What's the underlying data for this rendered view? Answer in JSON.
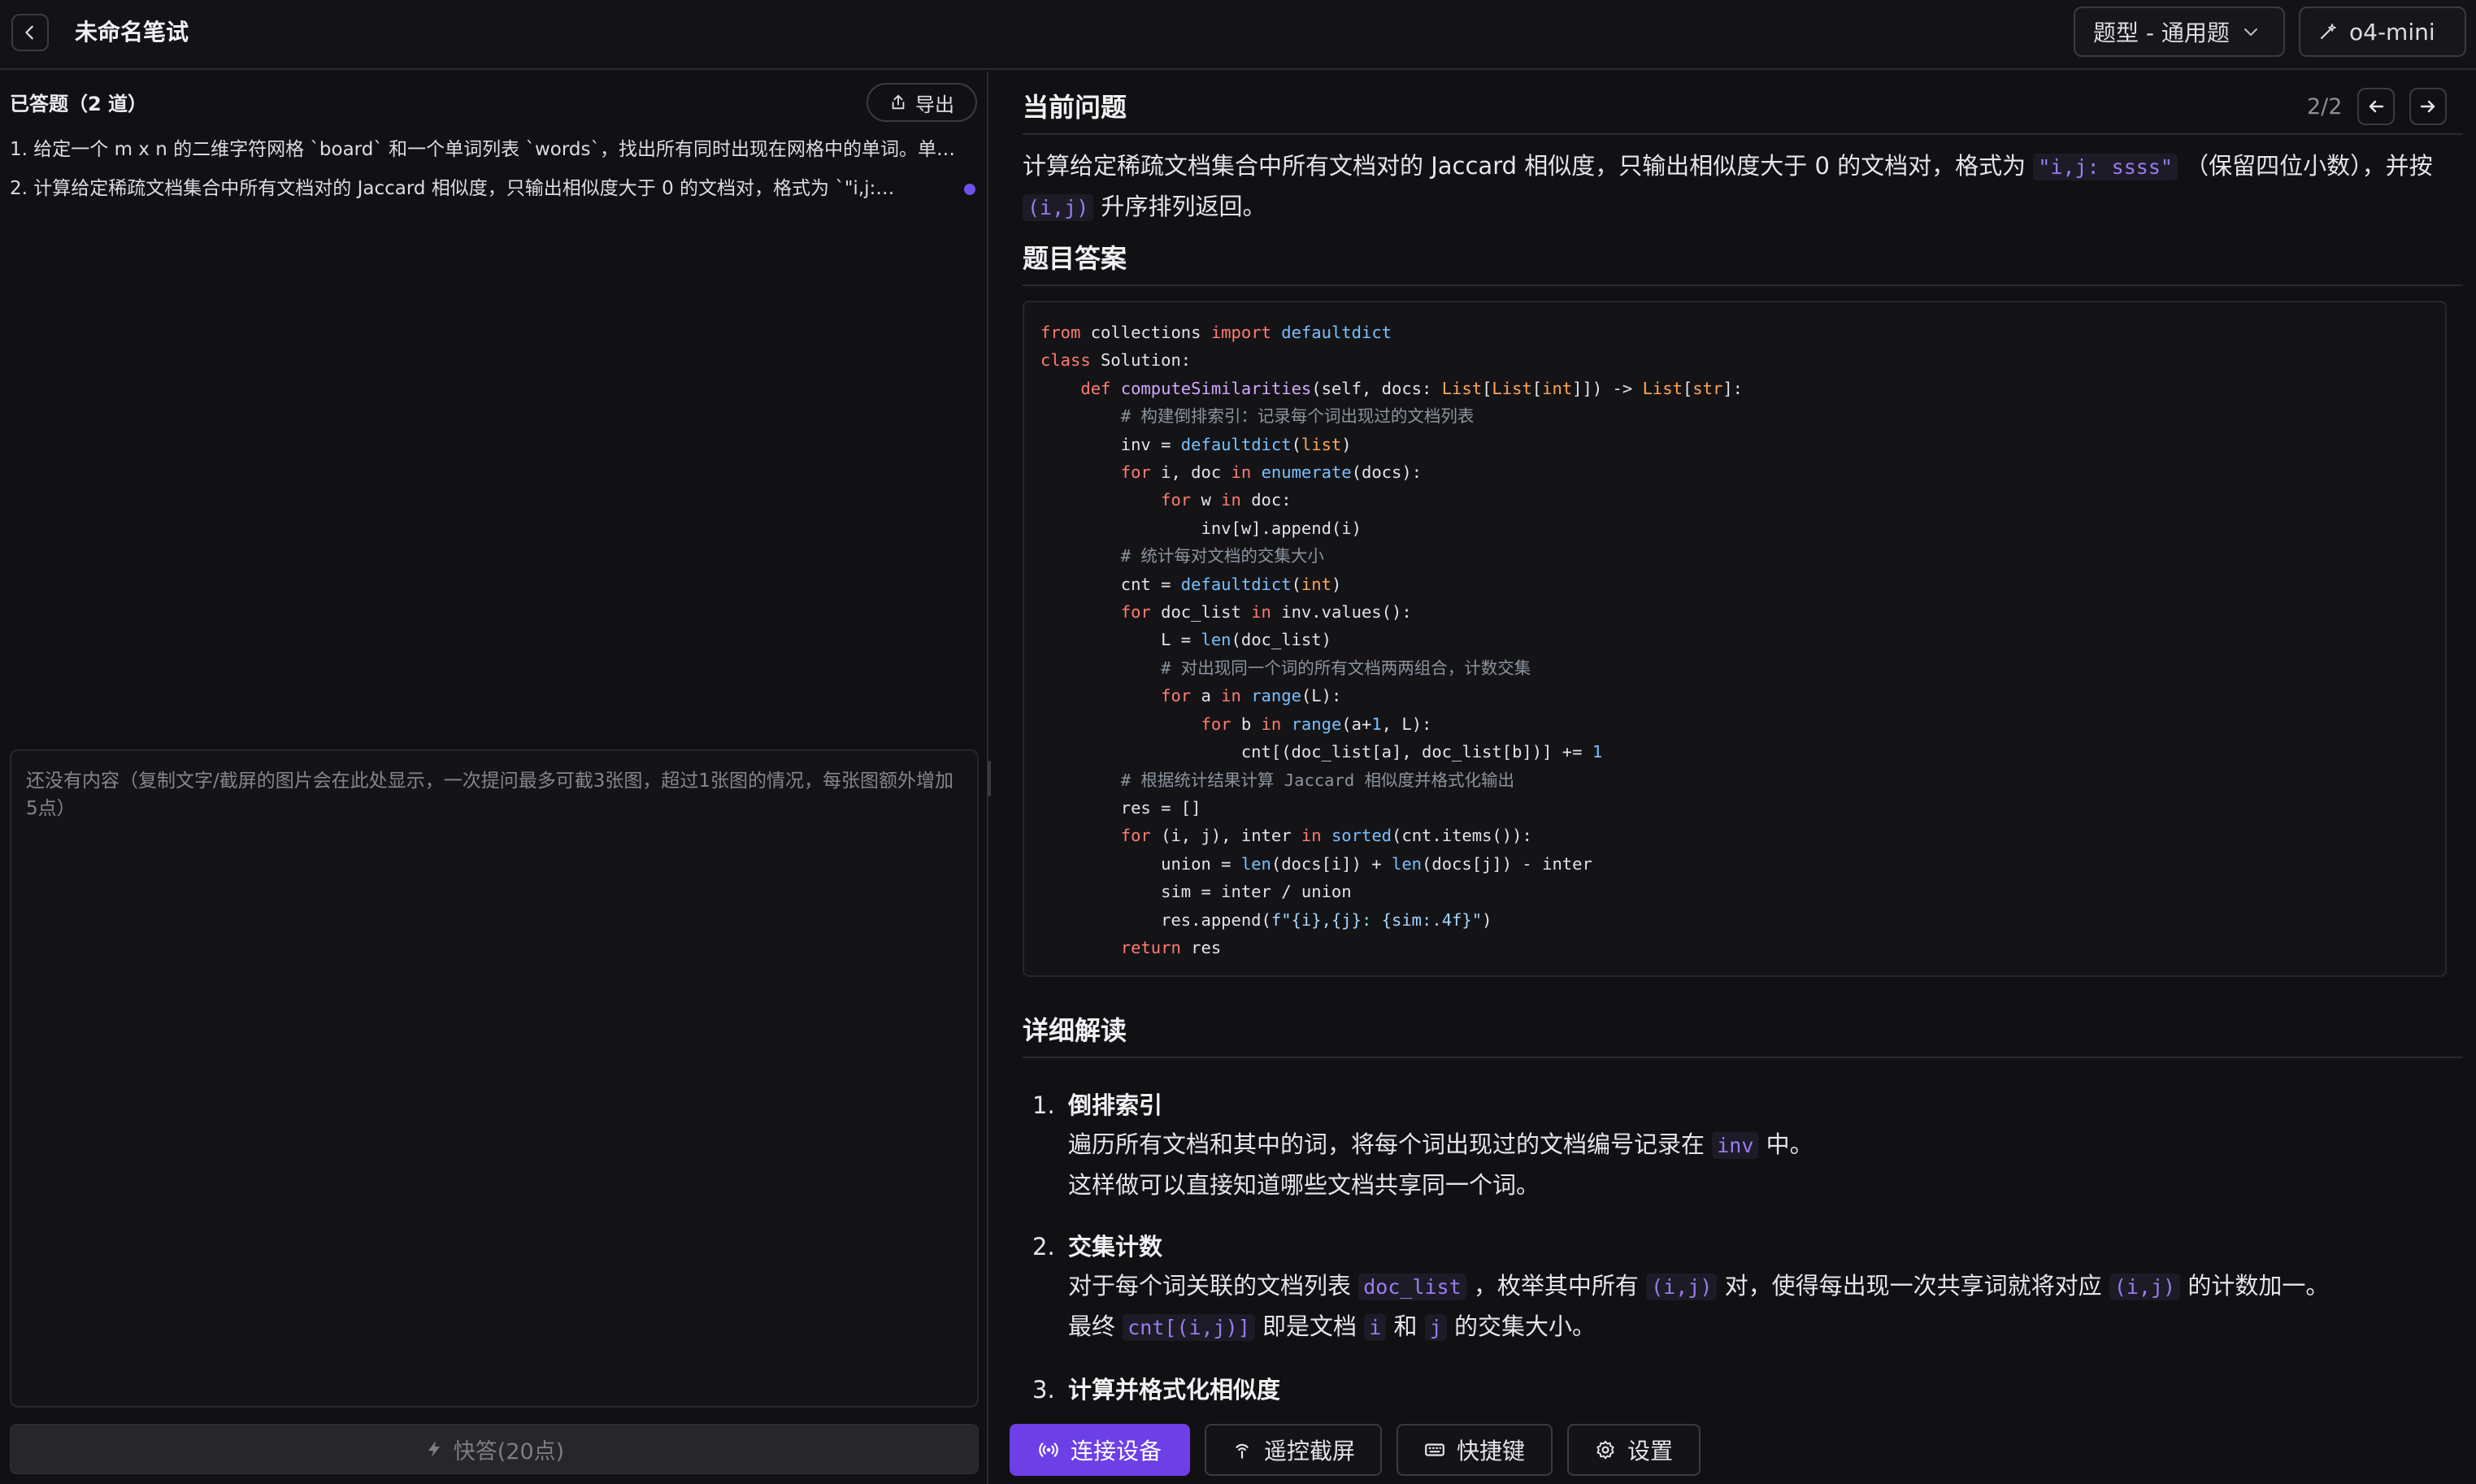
{
  "header": {
    "title": "未命名笔试",
    "type_select": "题型 - 通用题",
    "model_select": "o4-mini"
  },
  "left": {
    "answered_header": "已答题（2 道）",
    "export_label": "导出",
    "questions": [
      "1. 给定一个 m x n 的二维字符网格 `board` 和一个单词列表 `words`，找出所有同时出现在网格中的单词。单…",
      "2. 计算给定稀疏文档集合中所有文档对的 Jaccard 相似度，只输出相似度大于 0 的文档对，格式为 `\"i,j:…"
    ],
    "input_placeholder": "还没有内容（复制文字/截屏的图片会在此处显示，一次提问最多可截3张图，超过1张图的情况，每张图额外增加5点）",
    "quick_answer_label": "快答(20点)"
  },
  "right": {
    "current_title": "当前问题",
    "pager": "2/2",
    "question": {
      "part1": "计算给定稀疏文档集合中所有文档对的 Jaccard 相似度，只输出相似度大于 0 的文档对，格式为",
      "code1": "\"i,j: ssss\"",
      "part2": "（保留四位小数），并按",
      "code2": "(i,j)",
      "part3": "升序排列返回。"
    },
    "answer_title": "题目答案",
    "code": [
      "from collections import defaultdict",
      "class Solution:",
      "    def computeSimilarities(self, docs: List[List[int]]) -> List[str]:",
      "        # 构建倒排索引：记录每个词出现过的文档列表",
      "        inv = defaultdict(list)",
      "        for i, doc in enumerate(docs):",
      "            for w in doc:",
      "                inv[w].append(i)",
      "        # 统计每对文档的交集大小",
      "        cnt = defaultdict(int)",
      "        for doc_list in inv.values():",
      "            L = len(doc_list)",
      "            # 对出现同一个词的所有文档两两组合，计数交集",
      "            for a in range(L):",
      "                for b in range(a+1, L):",
      "                    cnt[(doc_list[a], doc_list[b])] += 1",
      "        # 根据统计结果计算 Jaccard 相似度并格式化输出",
      "        res = []",
      "        for (i, j), inter in sorted(cnt.items()):",
      "            union = len(docs[i]) + len(docs[j]) - inter",
      "            sim = inter / union",
      "            res.append(f\"{i},{j}: {sim:.4f}\")",
      "        return res"
    ],
    "detail_title": "详细解读",
    "steps": [
      {
        "num": "1.",
        "title": "倒排索引",
        "l1a": "遍历所有文档和其中的词，将每个词出现过的文档编号记录在",
        "l1b": "inv",
        "l1c": "中。",
        "l2": "这样做可以直接知道哪些文档共享同一个词。"
      },
      {
        "num": "2.",
        "title": "交集计数",
        "l1a": "对于每个词关联的文档列表",
        "l1b": "doc_list",
        "l1c": "，枚举其中所有",
        "l1d": "(i,j)",
        "l1e": "对，使得每出现一次共享词就将对应",
        "l1f": "(i,j)",
        "l1g": "的计数加一。",
        "l2a": "最终",
        "l2b": "cnt[(i,j)]",
        "l2c": "即是文档",
        "l2d": "i",
        "l2e": "和",
        "l2f": "j",
        "l2g": "的交集大小。"
      },
      {
        "num": "3.",
        "title": "计算并格式化相似度"
      }
    ]
  },
  "toolbar": {
    "connect": "连接设备",
    "remote": "遥控截屏",
    "shortcut": "快捷键",
    "settings": "设置"
  },
  "colors": {
    "accent": "#6d3fe6",
    "background": "#111114",
    "inline_code": "#9a7cf0"
  }
}
